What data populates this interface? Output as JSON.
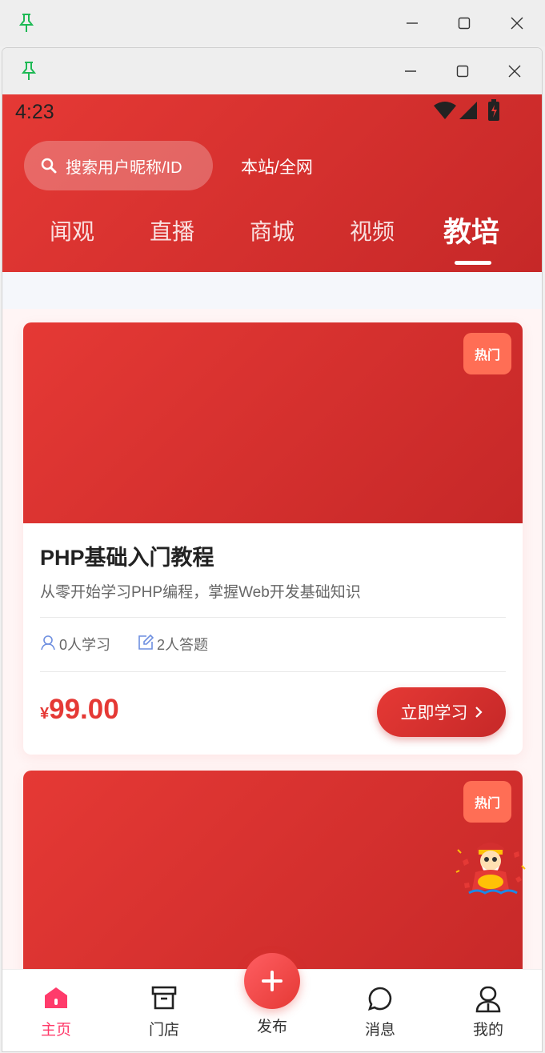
{
  "outer_window": {
    "buttons": [
      "pin",
      "minimize",
      "maximize",
      "close"
    ]
  },
  "inner_window": {
    "buttons": [
      "pin",
      "minimize",
      "maximize",
      "close"
    ]
  },
  "status_bar": {
    "time": "4:23"
  },
  "header": {
    "search_placeholder": "搜索用户昵称/ID",
    "scope_toggle": "本站/全网",
    "tabs": [
      {
        "label": "闻观",
        "active": false
      },
      {
        "label": "直播",
        "active": false
      },
      {
        "label": "商城",
        "active": false
      },
      {
        "label": "视频",
        "active": false
      },
      {
        "label": "教培",
        "active": true
      }
    ]
  },
  "courses": [
    {
      "badge": "热门",
      "title": "PHP基础入门教程",
      "description": "从零开始学习PHP编程，掌握Web开发基础知识",
      "learners": "0人学习",
      "answers": "2人答题",
      "price_symbol": "¥",
      "price": "99.00",
      "cta": "立即学习"
    },
    {
      "badge": "热门"
    }
  ],
  "bottom_nav": {
    "items": [
      {
        "label": "主页",
        "icon": "home-icon",
        "active": true
      },
      {
        "label": "门店",
        "icon": "store-icon",
        "active": false
      },
      {
        "label": "发布",
        "icon": "plus-icon",
        "active": false
      },
      {
        "label": "消息",
        "icon": "chat-icon",
        "active": false
      },
      {
        "label": "我的",
        "icon": "profile-icon",
        "active": false
      }
    ]
  },
  "colors": {
    "brand": "#e53935",
    "brand_dark": "#c62828",
    "badge": "#ff6e55",
    "nav_active": "#ff3b6b"
  }
}
